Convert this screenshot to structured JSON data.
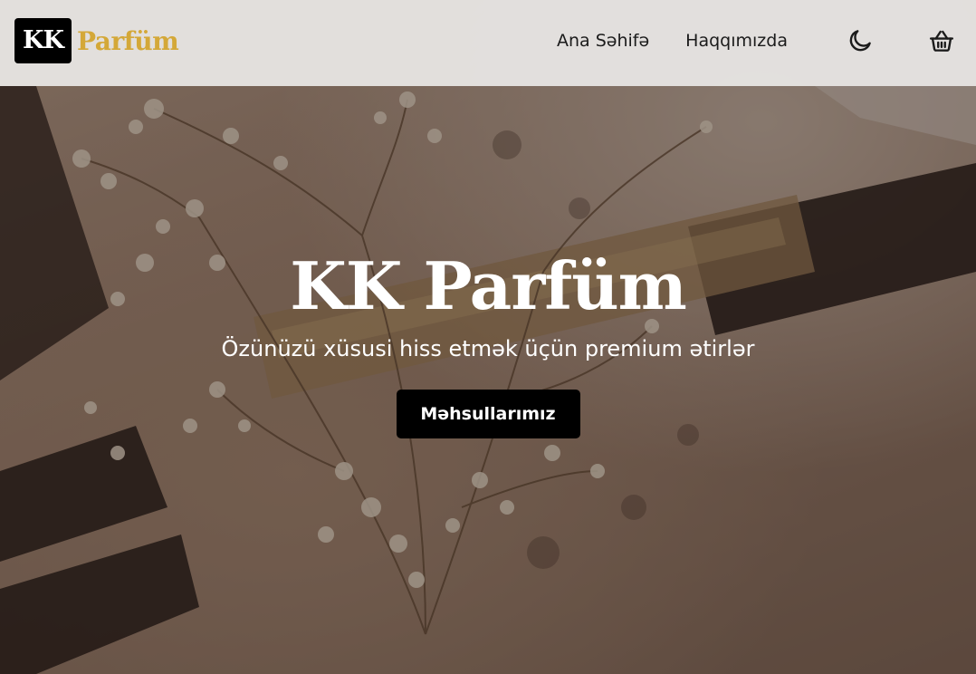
{
  "header": {
    "logo_mark": "KK",
    "logo_text": "Parfüm",
    "nav": {
      "home": "Ana Səhifə",
      "about": "Haqqımızda"
    },
    "icons": {
      "theme": "moon-icon",
      "cart": "basket-icon"
    }
  },
  "hero": {
    "title": "KK Parfüm",
    "subtitle": "Özünüzü xüsusi hiss etmək üçün premium ətirlər",
    "cta_label": "Məhsullarımız"
  },
  "colors": {
    "brand_gold": "#d4a838",
    "header_bg": "#e6e4e2",
    "button_bg": "#000000",
    "text_light": "#ffffff"
  }
}
